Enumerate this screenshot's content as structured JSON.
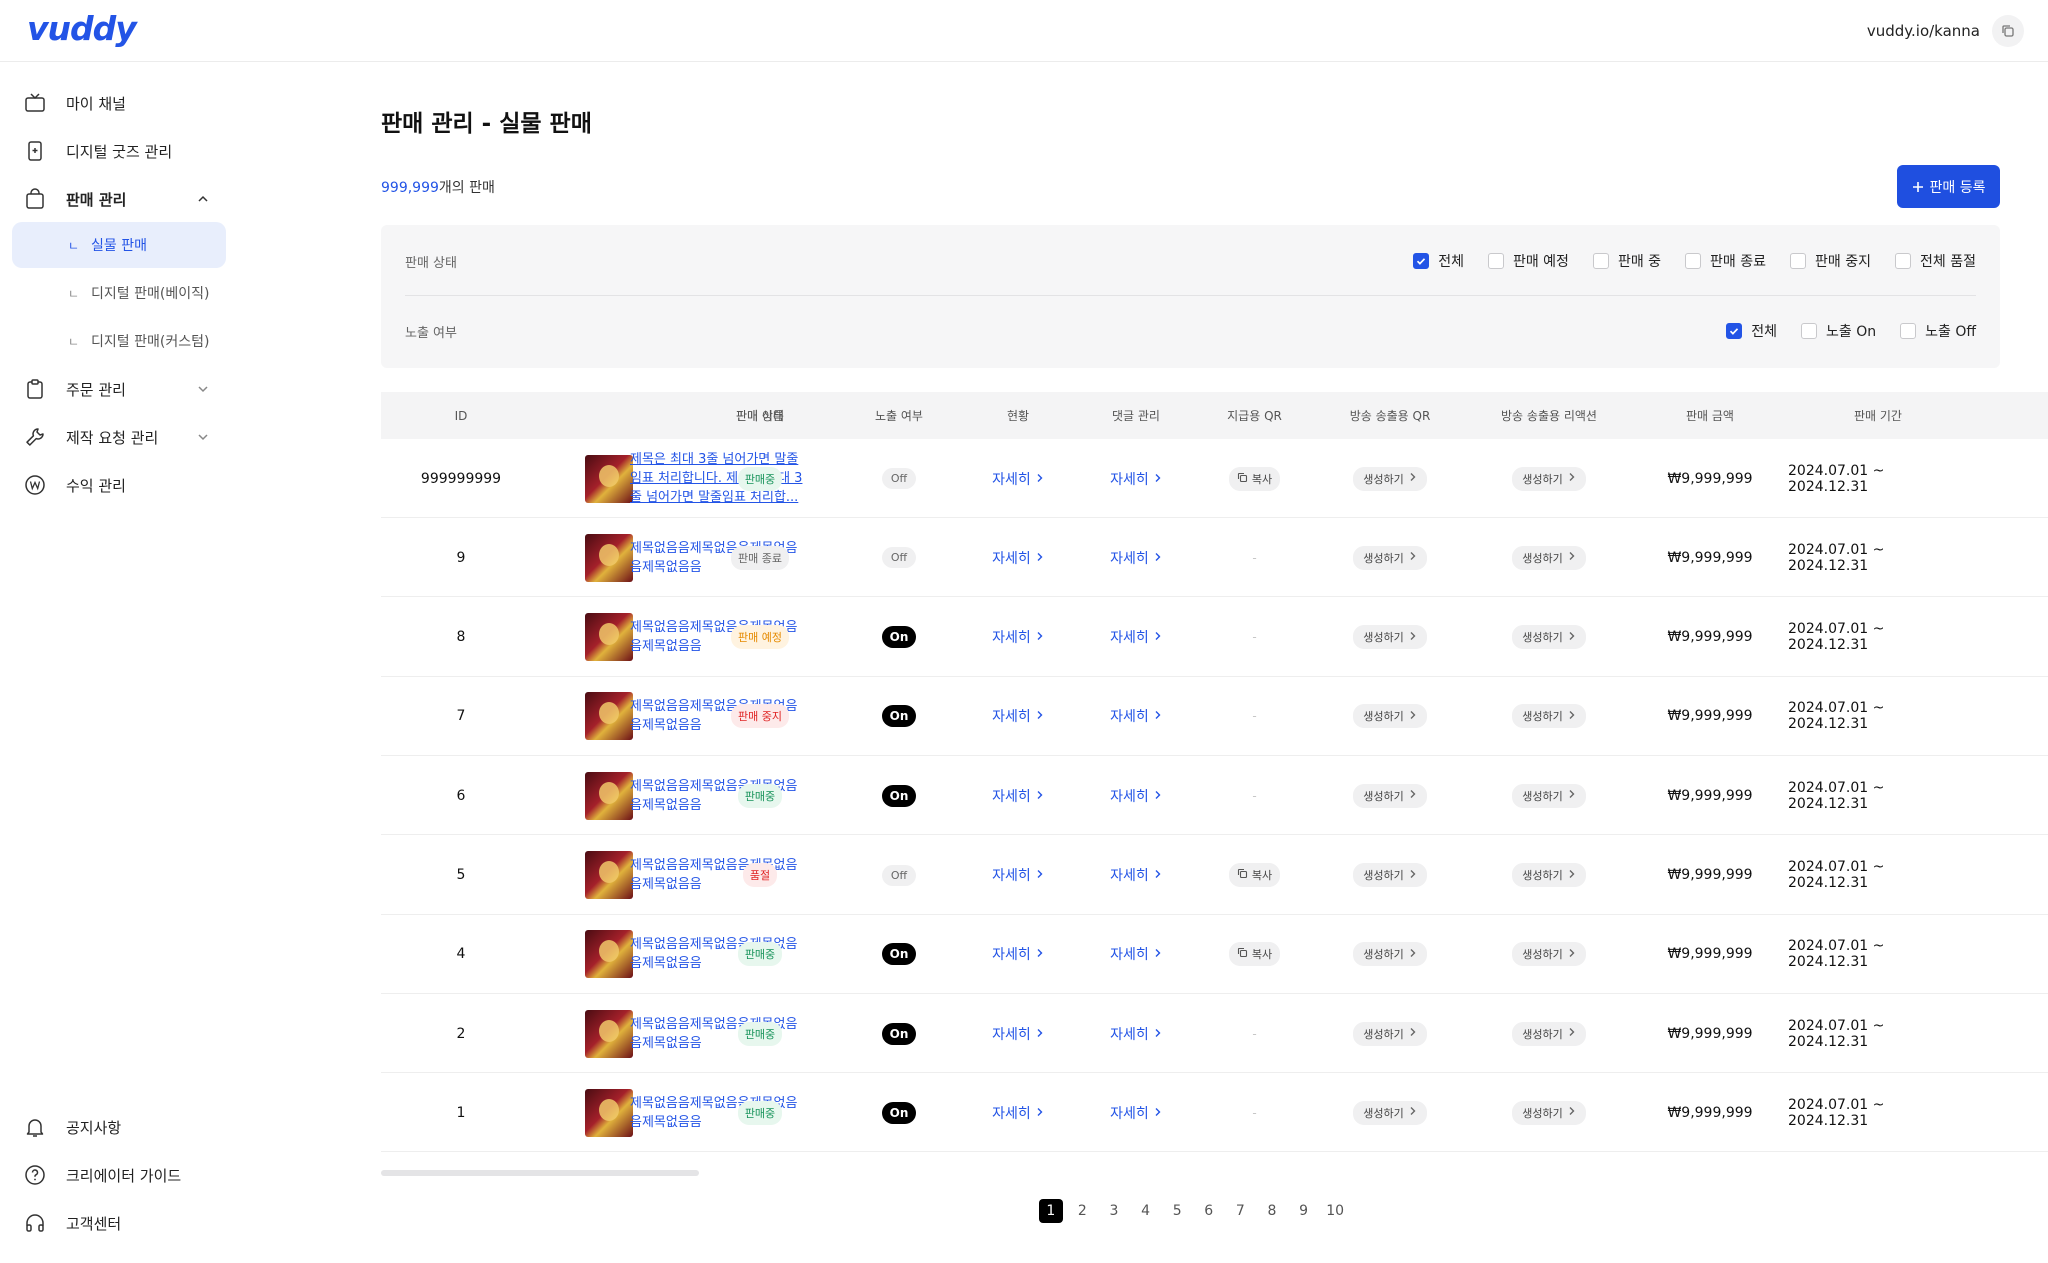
{
  "brand": {
    "logo": "vuddy",
    "accent": "#2354e6"
  },
  "header": {
    "url": "vuddy.io/kanna"
  },
  "sidebar": {
    "items": [
      {
        "label": "마이 채널",
        "icon": "tv-icon"
      },
      {
        "label": "디지털 굿즈 관리",
        "icon": "phone-plus-icon"
      },
      {
        "label": "판매 관리",
        "icon": "shopping-bag-icon"
      },
      {
        "label": "주문 관리",
        "icon": "clipboard-icon"
      },
      {
        "label": "제작 요청 관리",
        "icon": "wrench-icon"
      },
      {
        "label": "수익 관리",
        "icon": "won-coin-icon"
      }
    ],
    "sub_items": [
      {
        "label": "실물 판매",
        "active": true
      },
      {
        "label": "디지털 판매(베이직)"
      },
      {
        "label": "디지털 판매(커스텀)"
      }
    ],
    "bottom": [
      {
        "label": "공지사항",
        "icon": "bell-icon"
      },
      {
        "label": "크리에이터 가이드",
        "icon": "help-circle-icon"
      },
      {
        "label": "고객센터",
        "icon": "headphones-icon"
      }
    ]
  },
  "main": {
    "title": "판매 관리 - 실물 판매",
    "count_value": "999,999",
    "count_suffix": "개의 판매",
    "add_button": "판매 등록"
  },
  "filters": {
    "status_label": "판매 상태",
    "status_options": [
      {
        "label": "전체",
        "checked": true
      },
      {
        "label": "판매 예정",
        "checked": false
      },
      {
        "label": "판매 중",
        "checked": false
      },
      {
        "label": "판매 종료",
        "checked": false
      },
      {
        "label": "판매 중지",
        "checked": false
      },
      {
        "label": "전체 품절",
        "checked": false
      }
    ],
    "exposure_label": "노출 여부",
    "exposure_options": [
      {
        "label": "전체",
        "checked": true
      },
      {
        "label": "노출 On",
        "checked": false
      },
      {
        "label": "노출 Off",
        "checked": false
      }
    ]
  },
  "table": {
    "headers": [
      "ID",
      "판매 이름",
      "판매 상태",
      "노출 여부",
      "현황",
      "댓글 관리",
      "지급용 QR",
      "방송 송출용 QR",
      "방송 송출용 리액션",
      "판매 금액",
      "판매 기간"
    ],
    "detail_label": "자세히",
    "copy_label": "복사",
    "generate_label": "생성하기",
    "dash": "-",
    "rows": [
      {
        "id": "999999999",
        "title": "제목은 최대 3줄 넘어가면 말줄임표 처리합니다. 제목은 최대 3줄 넘어가면 말줄임표 처리합...",
        "status": "판매중",
        "status_style": "green",
        "exposure": "Off",
        "qr": "copy",
        "price": "₩9,999,999",
        "period": "2024.07.01 ~ 2024.12.31"
      },
      {
        "id": "9",
        "title": "제목없음음제목없음음제목없음음제목없음음",
        "status": "판매 종료",
        "status_style": "gray",
        "exposure": "Off",
        "qr": "dash",
        "price": "₩9,999,999",
        "period": "2024.07.01 ~ 2024.12.31"
      },
      {
        "id": "8",
        "title": "제목없음음제목없음음제목없음음제목없음음",
        "status": "판매 예정",
        "status_style": "orange",
        "exposure": "On",
        "qr": "dash",
        "price": "₩9,999,999",
        "period": "2024.07.01 ~ 2024.12.31"
      },
      {
        "id": "7",
        "title": "제목없음음제목없음음제목없음음제목없음음",
        "status": "판매 중지",
        "status_style": "red",
        "exposure": "On",
        "qr": "dash",
        "price": "₩9,999,999",
        "period": "2024.07.01 ~ 2024.12.31"
      },
      {
        "id": "6",
        "title": "제목없음음제목없음음제목없음음제목없음음",
        "status": "판매중",
        "status_style": "green",
        "exposure": "On",
        "qr": "dash",
        "price": "₩9,999,999",
        "period": "2024.07.01 ~ 2024.12.31"
      },
      {
        "id": "5",
        "title": "제목없음음제목없음음제목없음음제목없음음",
        "status": "품절",
        "status_style": "red",
        "exposure": "Off",
        "qr": "copy",
        "price": "₩9,999,999",
        "period": "2024.07.01 ~ 2024.12.31"
      },
      {
        "id": "4",
        "title": "제목없음음제목없음음제목없음음제목없음음",
        "status": "판매중",
        "status_style": "green",
        "exposure": "On",
        "qr": "copy",
        "price": "₩9,999,999",
        "period": "2024.07.01 ~ 2024.12.31"
      },
      {
        "id": "2",
        "title": "제목없음음제목없음음제목없음음제목없음음",
        "status": "판매중",
        "status_style": "green",
        "exposure": "On",
        "qr": "dash",
        "price": "₩9,999,999",
        "period": "2024.07.01 ~ 2024.12.31"
      },
      {
        "id": "1",
        "title": "제목없음음제목없음음제목없음음제목없음음",
        "status": "판매중",
        "status_style": "green",
        "exposure": "On",
        "qr": "dash",
        "price": "₩9,999,999",
        "period": "2024.07.01 ~ 2024.12.31"
      }
    ]
  },
  "pagination": {
    "pages": [
      "1",
      "2",
      "3",
      "4",
      "5",
      "6",
      "7",
      "8",
      "9",
      "10"
    ],
    "current": "1"
  }
}
